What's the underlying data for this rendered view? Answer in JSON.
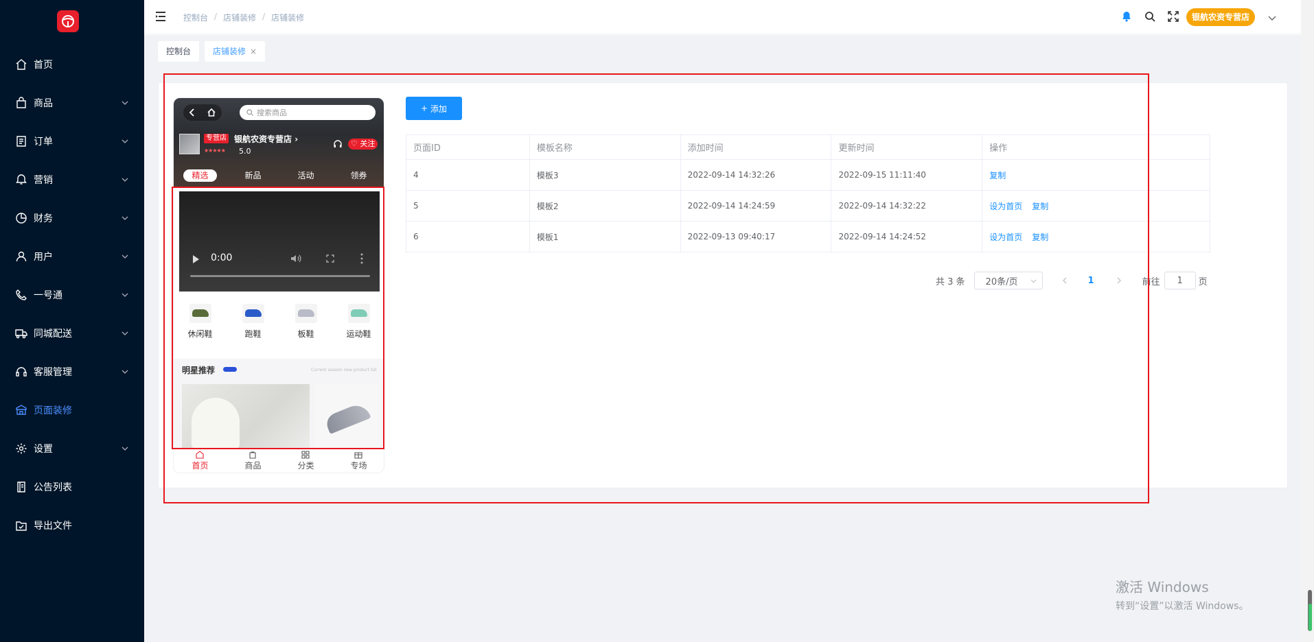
{
  "sidebar": {
    "logo_icon": "steering-wheel-logo-icon",
    "items": [
      {
        "label": "首页",
        "icon": "home-icon",
        "expandable": false
      },
      {
        "label": "商品",
        "icon": "bag-icon",
        "expandable": true
      },
      {
        "label": "订单",
        "icon": "order-list-icon",
        "expandable": true
      },
      {
        "label": "营销",
        "icon": "bell-outline-icon",
        "expandable": true
      },
      {
        "label": "财务",
        "icon": "pie-clock-icon",
        "expandable": true
      },
      {
        "label": "用户",
        "icon": "user-icon",
        "expandable": true
      },
      {
        "label": "一号通",
        "icon": "phone-icon",
        "expandable": true
      },
      {
        "label": "同城配送",
        "icon": "truck-icon",
        "expandable": true
      },
      {
        "label": "客服管理",
        "icon": "headset-icon",
        "expandable": true
      },
      {
        "label": "页面装修",
        "icon": "decorate-icon",
        "expandable": false,
        "active": true
      },
      {
        "label": "设置",
        "icon": "gear-icon",
        "expandable": true
      },
      {
        "label": "公告列表",
        "icon": "notice-icon",
        "expandable": false
      },
      {
        "label": "导出文件",
        "icon": "export-folder-icon",
        "expandable": false
      }
    ]
  },
  "header": {
    "breadcrumb": [
      "控制台",
      "店铺装修",
      "店铺装修"
    ],
    "shop_name": "银航农资专营店"
  },
  "tags": [
    {
      "label": "控制台",
      "active": false
    },
    {
      "label": "店铺装修",
      "active": true,
      "closable": true
    }
  ],
  "preview": {
    "search_placeholder": "搜索商品",
    "store_tag": "专营店",
    "store_name": "银航农资专营店",
    "stars": "★★★★★",
    "score": "5.0",
    "follow_label": "关注",
    "tabs": [
      {
        "label": "精选",
        "active": true
      },
      {
        "label": "新品",
        "active": false
      },
      {
        "label": "活动",
        "active": false
      },
      {
        "label": "领券",
        "active": false
      }
    ],
    "video_time": "0:00",
    "categories": [
      {
        "label": "休闲鞋",
        "color": "#5a6b3a"
      },
      {
        "label": "跑鞋",
        "color": "#2a5bc8"
      },
      {
        "label": "板鞋",
        "color": "#b9bcc8"
      },
      {
        "label": "运动鞋",
        "color": "#7fcdb6"
      }
    ],
    "rec_title": "明星推荐",
    "rec_subtitle": "Current season new product list",
    "tabbar": [
      {
        "label": "首页",
        "active": true
      },
      {
        "label": "商品",
        "active": false
      },
      {
        "label": "分类",
        "active": false
      },
      {
        "label": "专场",
        "active": false
      }
    ]
  },
  "main": {
    "add_label": "添加",
    "table": {
      "headers": [
        "页面ID",
        "模板名称",
        "添加时间",
        "更新时间",
        "操作"
      ],
      "rows": [
        {
          "id": "4",
          "name": "模板3",
          "added": "2022-09-14 14:32:26",
          "updated": "2022-09-15 11:11:40",
          "actions": [
            "复制"
          ]
        },
        {
          "id": "5",
          "name": "模板2",
          "added": "2022-09-14 14:24:59",
          "updated": "2022-09-14 14:32:22",
          "actions": [
            "设为首页",
            "复制"
          ]
        },
        {
          "id": "6",
          "name": "模板1",
          "added": "2022-09-13 09:40:17",
          "updated": "2022-09-14 14:24:52",
          "actions": [
            "设为首页",
            "复制"
          ]
        }
      ]
    },
    "pagination": {
      "total": "共 3 条",
      "page_size": "20条/页",
      "current": "1",
      "goto_label": "前往",
      "goto_value": "1",
      "goto_unit": "页"
    }
  },
  "watermark": {
    "line1": "激活 Windows",
    "line2": "转到“设置”以激活 Windows。"
  },
  "colors": {
    "sidebar_bg": "#001529",
    "accent": "#1890ff",
    "brand_red": "#e8202c",
    "shop_badge": "#f6a609"
  }
}
